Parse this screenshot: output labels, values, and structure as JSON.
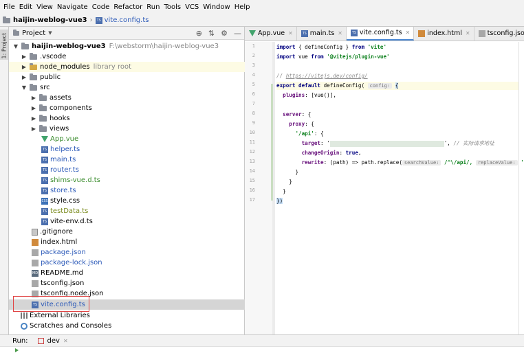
{
  "menu": [
    "File",
    "Edit",
    "View",
    "Navigate",
    "Code",
    "Refactor",
    "Run",
    "Tools",
    "VCS",
    "Window",
    "Help"
  ],
  "breadcrumb": {
    "project": "haijin-weblog-vue3",
    "file": "vite.config.ts"
  },
  "left_strip": {
    "tab": "1: Project"
  },
  "project_panel": {
    "title": "Project",
    "root": {
      "name": "haijin-weblog-vue3",
      "path": "F:\\webstorm\\haijin-weblog-vue3"
    },
    "items": {
      "vscode": ".vscode",
      "node_modules": "node_modules",
      "node_modules_hint": "library root",
      "public": "public",
      "src": "src",
      "assets": "assets",
      "components": "components",
      "hooks": "hooks",
      "views": "views",
      "app_vue": "App.vue",
      "helper_ts": "helper.ts",
      "main_ts": "main.ts",
      "router_ts": "router.ts",
      "shims_vue": "shims-vue.d.ts",
      "store_ts": "store.ts",
      "style_css": "style.css",
      "testdata_ts": "testData.ts",
      "vite_env": "vite-env.d.ts",
      "gitignore": ".gitignore",
      "index_html": "index.html",
      "package_json": "package.json",
      "package_lock": "package-lock.json",
      "readme": "README.md",
      "tsconfig": "tsconfig.json",
      "tsconfig_node": "tsconfig.node.json",
      "vite_config": "vite.config.ts",
      "ext_libs": "External Libraries",
      "scratches": "Scratches and Consoles"
    }
  },
  "tabs": [
    "App.vue",
    "main.ts",
    "vite.config.ts",
    "index.html",
    "tsconfig.json"
  ],
  "active_tab": "vite.config.ts",
  "line_numbers": [
    "1",
    "2",
    "3",
    "4",
    "5",
    "6",
    "7",
    "8",
    "9",
    "10",
    "11",
    "12",
    "13",
    "14",
    "15",
    "16",
    "17"
  ],
  "code": {
    "l1_import": "import",
    "l1_mid": " { defineConfig } ",
    "l1_from": "from",
    "l1_src": " 'vite'",
    "l2_import": "import",
    "l2_mid": " vue ",
    "l2_from": "from",
    "l2_src": " '@vitejs/plugin-vue'",
    "l4_comment_prefix": "// ",
    "l4_url": "https://vitejs.dev/config/",
    "l5_export": "export default",
    "l5_call": " defineConfig(",
    "l5_hint": "config:",
    "l5_brace": "{",
    "l6_key": "plugins",
    "l6_val": ": [vue()],",
    "l8_key": "server",
    "l8_val": ": {",
    "l9_key": "proxy",
    "l9_val": ": {",
    "l10_key": "'/api'",
    "l10_val": ": {",
    "l11_key": "target",
    "l11_q": ": '",
    "l11_tail": "', ",
    "l11_comment": "// 实际请求地址",
    "l12_key": "changeOrigin",
    "l12_val": "true",
    "l13_key": "rewrite",
    "l13_arrow": ": (path) => path.replace(",
    "l13_hint1": "searchValue:",
    "l13_regex": " /^\\/api/, ",
    "l13_hint2": "replaceValue:",
    "l13_end": " '')",
    "l14": "}",
    "l15": "}",
    "l16": "}",
    "l17": "})"
  },
  "run_panel": {
    "label": "Run:",
    "config": "dev"
  }
}
